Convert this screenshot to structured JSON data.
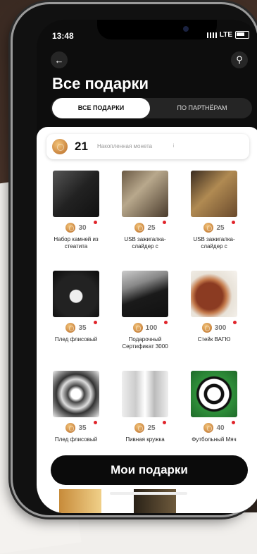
{
  "status": {
    "time": "13:48",
    "network": "LTE"
  },
  "header": {
    "title": "Все подарки"
  },
  "tabs": [
    {
      "label": "ВСЕ ПОДАРКИ",
      "active": true
    },
    {
      "label": "ПО ПАРТНЁРАМ",
      "active": false
    }
  ],
  "coins": {
    "amount": "21",
    "label": "Накопленная монета",
    "info": "i"
  },
  "products": [
    {
      "price": "30",
      "name": "Набор камней из стеатита"
    },
    {
      "price": "25",
      "name": "USB зажигалка-слайдер с"
    },
    {
      "price": "25",
      "name": "USB зажигалка-слайдер с"
    },
    {
      "price": "35",
      "name": "Плед флисовый"
    },
    {
      "price": "100",
      "name": "Подарочный Сертификат 3000"
    },
    {
      "price": "300",
      "name": "Стейк ВАГЮ"
    },
    {
      "price": "35",
      "name": "Плед флисовый"
    },
    {
      "price": "25",
      "name": "Пивная кружка"
    },
    {
      "price": "40",
      "name": "Футбольный Мяч"
    }
  ],
  "cta": {
    "label": "Мои подарки"
  },
  "colors": {
    "accent": "#0b0b0b",
    "badge": "#e0242b",
    "coin": "#c9843e"
  }
}
